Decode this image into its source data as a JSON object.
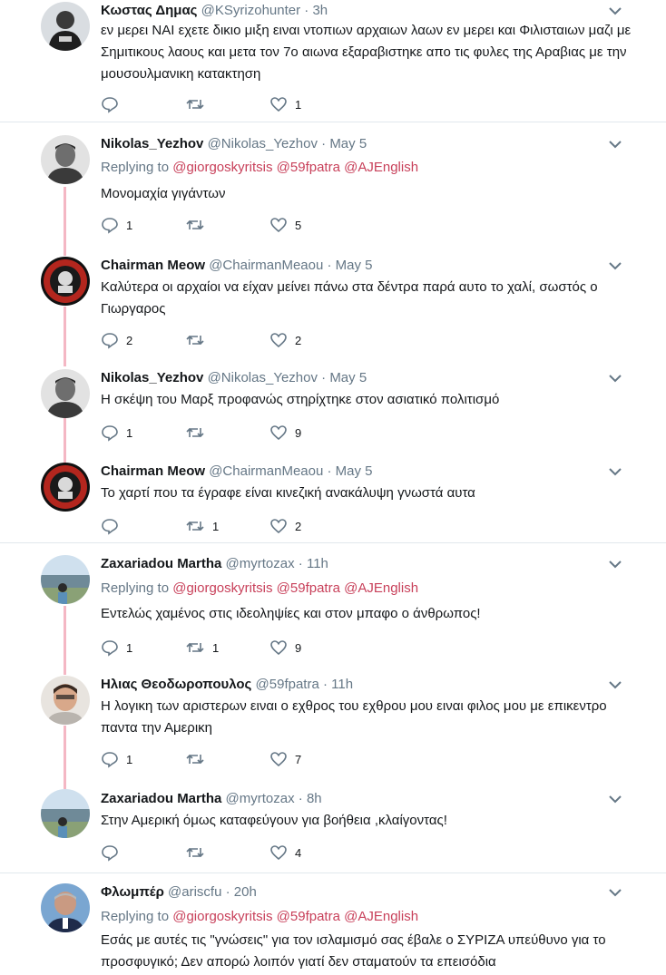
{
  "tweets": [
    {
      "name": "Κωστας Δημας",
      "handle": "@KSyrizohunter",
      "time": "3h",
      "reply_to": null,
      "text": "εν μερει ΝΑΙ εχετε δικιο μιξη ειναι ντοπιων αρχαιων λαων εν μερει και Φιλισταιων μαζι με Σημιτικους λαους και μετα τον 7ο αιωνα εξαραβιστηκε απο τις φυλες της Αραβιας με την μουσουλμανικη κατακτηση",
      "replies": "",
      "retweets": "",
      "likes": "1"
    },
    {
      "name": "Nikolas_Yezhov",
      "handle": "@Nikolas_Yezhov",
      "time": "May 5",
      "reply_to": {
        "prefix": "Replying to",
        "mentions": [
          "@giorgoskyritsis",
          "@59fpatra",
          "@AJEnglish"
        ]
      },
      "text": "Μονομαχία γιγάντων",
      "replies": "1",
      "retweets": "",
      "likes": "5"
    },
    {
      "name": "Chairman Meow",
      "handle": "@ChairmanMeaou",
      "time": "May 5",
      "reply_to": null,
      "text": "Καλύτερα οι αρχαίοι να είχαν μείνει πάνω στα δέντρα παρά αυτο το χαλί, σωστός ο Γιωργαρος",
      "replies": "2",
      "retweets": "",
      "likes": "2"
    },
    {
      "name": "Nikolas_Yezhov",
      "handle": "@Nikolas_Yezhov",
      "time": "May 5",
      "reply_to": null,
      "text": "Η σκέψη του Μαρξ προφανώς στηρίχτηκε στον ασιατικό πολιτισμό",
      "replies": "1",
      "retweets": "",
      "likes": "9"
    },
    {
      "name": "Chairman Meow",
      "handle": "@ChairmanMeaou",
      "time": "May 5",
      "reply_to": null,
      "text": "Το χαρτί που τα έγραφε είναι κινεζική ανακάλυψη γνωστά αυτα",
      "replies": "",
      "retweets": "1",
      "likes": "2"
    },
    {
      "name": "Zaxariadou Martha",
      "handle": "@myrtozax",
      "time": "11h",
      "reply_to": {
        "prefix": "Replying to",
        "mentions": [
          "@giorgoskyritsis",
          "@59fpatra",
          "@AJEnglish"
        ]
      },
      "text": "Εντελώς χαμένος στις ιδεοληψίες και στον μπαφο ο άνθρωπος!",
      "replies": "1",
      "retweets": "1",
      "likes": "9"
    },
    {
      "name": "Ηλιας Θεοδωροπουλος",
      "handle": "@59fpatra",
      "time": "11h",
      "reply_to": null,
      "text": "Η λογικη των αριστερων ειναι ο εχθρος του εχθρου μου ειναι φιλος μου με επικεντρο παντα την Αμερικη",
      "replies": "1",
      "retweets": "",
      "likes": "7"
    },
    {
      "name": "Zaxariadou Martha",
      "handle": "@myrtozax",
      "time": "8h",
      "reply_to": null,
      "text": "Στην Αμερική όμως καταφεύγουν για βοήθεια ,κλαίγοντας!",
      "replies": "",
      "retweets": "",
      "likes": "4"
    },
    {
      "name": "Φλωμπέρ",
      "handle": "@ariscfu",
      "time": "20h",
      "reply_to": {
        "prefix": "Replying to",
        "mentions": [
          "@giorgoskyritsis",
          "@59fpatra",
          "@AJEnglish"
        ]
      },
      "text": "Εσάς με αυτές τις \"γνώσεις\" για τον ισλαμισμό σας έβαλε ο ΣΥΡΙΖΑ υπεύθυνο για το προσφυγικό; Δεν απορώ λοιπόν γιατί δεν σταματούν τα επεισόδια",
      "replies": "",
      "retweets": "",
      "likes": ""
    }
  ],
  "colors": {
    "mention": "#c8405a",
    "thread_line": "#f4b7c4",
    "icon": "#657786"
  },
  "icons": {
    "reply": "reply-icon",
    "retweet": "retweet-icon",
    "like": "heart-icon",
    "menu": "chevron-down-icon"
  }
}
